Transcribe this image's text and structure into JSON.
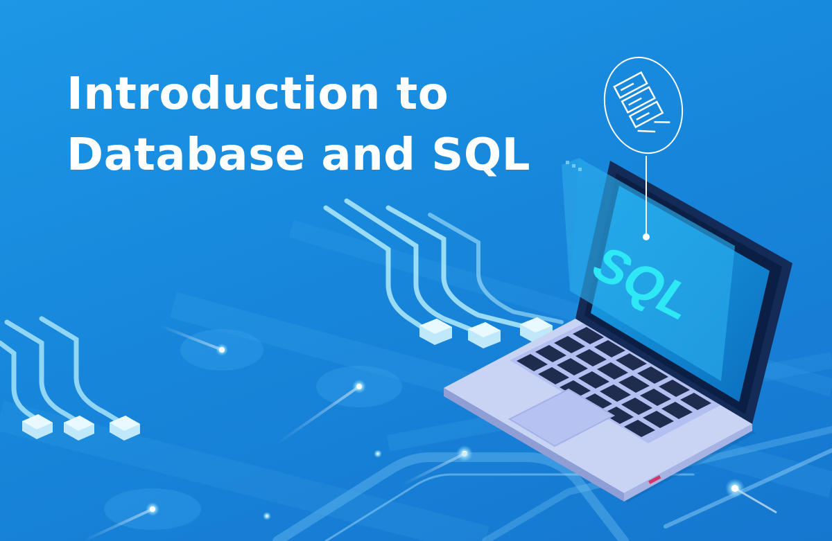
{
  "banner": {
    "title_line1": "Introduction to",
    "title_line2": "Database and SQL",
    "screen_text": "SQL"
  },
  "colors": {
    "background": "#1a86d8",
    "title_text": "#ffffff",
    "screen_text": "#2ee8f5",
    "laptop_body": "#c7d2f3",
    "laptop_keys": "#1f2c4d",
    "laptop_bezel": "#142b57",
    "glow": "#d9f8ff"
  },
  "icons": [
    "server-rack-icon",
    "ethernet-plug-icon"
  ]
}
